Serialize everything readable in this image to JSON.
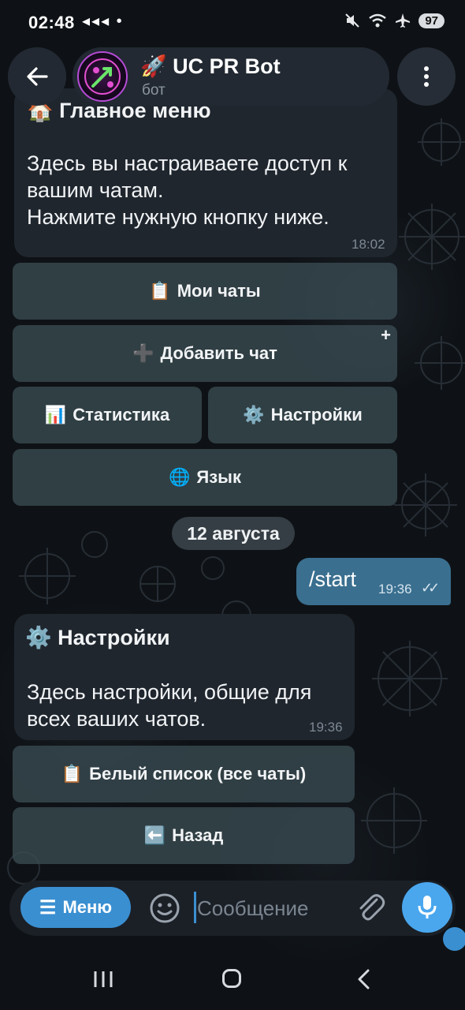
{
  "status": {
    "time": "02:48",
    "left_icons": "◂◂◂ •",
    "battery": "97"
  },
  "header": {
    "title": "🚀 UC PR Bot",
    "subtitle": "бот"
  },
  "messages": {
    "main_menu": {
      "heading": "🏠 Главное меню",
      "line1": "Здесь вы настраиваете доступ к",
      "line2": "вашим чатам.",
      "line3": "Нажмите нужную кнопку ниже.",
      "time": "18:02",
      "buttons": {
        "my_chats": {
          "emoji": "📋",
          "label": "Мои чаты"
        },
        "add_chat": {
          "emoji": "➕",
          "label": "Добавить чат",
          "corner": "+"
        },
        "stats": {
          "emoji": "📊",
          "label": "Статистика"
        },
        "settings": {
          "emoji": "⚙️",
          "label": "Настройки"
        },
        "language": {
          "emoji": "🌐",
          "label": "Язык"
        }
      }
    },
    "date_divider": "12 августа",
    "outgoing": {
      "text": "/start",
      "time": "19:36",
      "checks": "✓✓"
    },
    "settings_msg": {
      "heading": "⚙️ Настройки",
      "line1": "Здесь настройки, общие для",
      "line2": "всех ваших чатов.",
      "time": "19:36",
      "buttons": {
        "whitelist": {
          "emoji": "📋",
          "label": "Белый список (все чаты)"
        },
        "back": {
          "emoji": "⬅️",
          "label": "Назад"
        }
      }
    }
  },
  "input": {
    "menu_label": "Меню",
    "placeholder": "Сообщение"
  },
  "colors": {
    "accent": "#3a8fd1",
    "outgoing_bubble": "#3a6f8f",
    "incoming_bubble": "#1f262e"
  }
}
